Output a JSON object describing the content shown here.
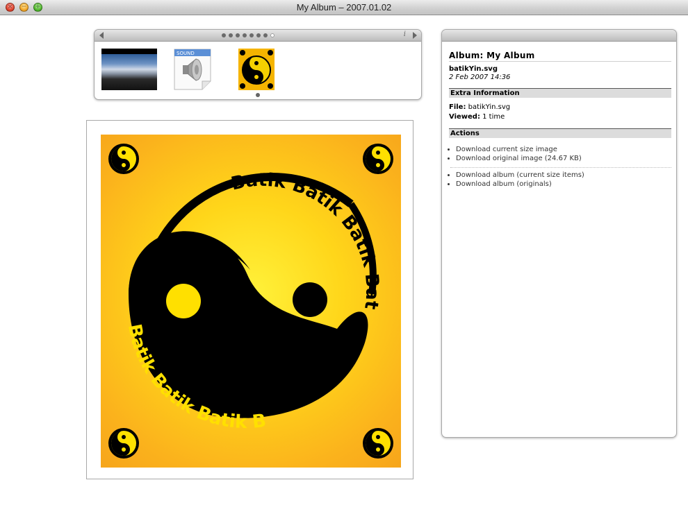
{
  "window": {
    "title": "My Album – 2007.01.02",
    "controls": [
      "close",
      "minimize",
      "zoom"
    ]
  },
  "thumbnail_strip": {
    "page_dots": 8,
    "active_dot_index": 7,
    "info_glyph": "i",
    "thumbnails": [
      {
        "name": "landscape-photo",
        "kind": "image"
      },
      {
        "name": "sound-file",
        "kind": "audio",
        "label": "SOUND"
      },
      {
        "name": "batikYin.svg",
        "kind": "image",
        "selected": true
      }
    ]
  },
  "main_image": {
    "text": "Batik Batik Batik Batik",
    "colors": {
      "background": "#ffd61a",
      "ink": "#000000"
    }
  },
  "panel": {
    "album_title": "Album: My Album",
    "file_name": "batikYin.svg",
    "file_date": "2 Feb 2007 14:36",
    "extra_header": "Extra Information",
    "file_label": "File:",
    "file_value": "batikYin.svg",
    "viewed_label": "Viewed:",
    "viewed_value": "1 time",
    "actions_header": "Actions",
    "actions_group1": [
      "Download current size image",
      "Download original image"
    ],
    "original_size": "(24.67 KB)",
    "actions_group2": [
      "Download album (current size items)",
      "Download album (originals)"
    ]
  }
}
